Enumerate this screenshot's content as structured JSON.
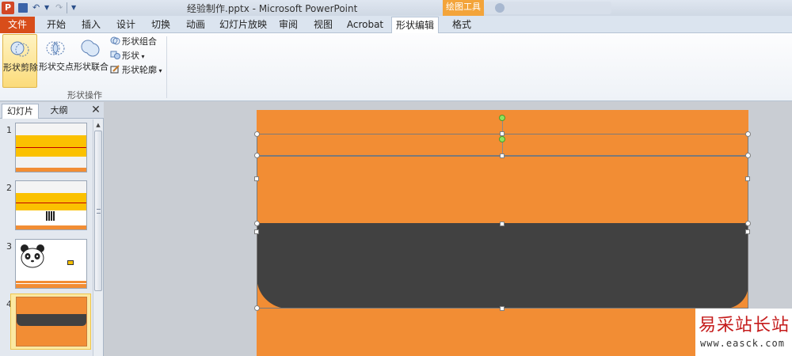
{
  "titlebar": {
    "app_icon": "P",
    "window_title": "经验制作.pptx - Microsoft PowerPoint",
    "tools_label": "绘图工具"
  },
  "tabs": [
    "文件",
    "开始",
    "插入",
    "设计",
    "切换",
    "动画",
    "幻灯片放映",
    "审阅",
    "视图",
    "Acrobat",
    "形状编辑",
    "格式"
  ],
  "active_tab": "形状编辑",
  "ribbon": {
    "subtract": "形状剪除",
    "intersect": "形状交点",
    "union": "形状联合",
    "combine": "形状组合",
    "shape": "形状",
    "outline": "形状轮廓",
    "group_label": "形状操作"
  },
  "left_pane": {
    "tab_slides": "幻灯片",
    "tab_outline": "大纲",
    "close": "✕",
    "slide_numbers": [
      "1",
      "2",
      "3",
      "4"
    ]
  },
  "colors": {
    "slide_orange": "#f28d34",
    "dark_shape": "#414141",
    "file_tab": "#d84d1a",
    "tools_header": "#f3a43a",
    "watermark_red": "#c51b1b"
  },
  "watermark": {
    "title": "易采站长站",
    "url": "www.easck.com"
  },
  "icons": [
    "powerpoint-icon",
    "save-icon",
    "undo-icon",
    "redo-icon",
    "subtract-shape-icon",
    "intersect-shape-icon",
    "union-shape-icon",
    "combine-shape-icon",
    "shape-icon",
    "outline-icon",
    "close-icon"
  ]
}
